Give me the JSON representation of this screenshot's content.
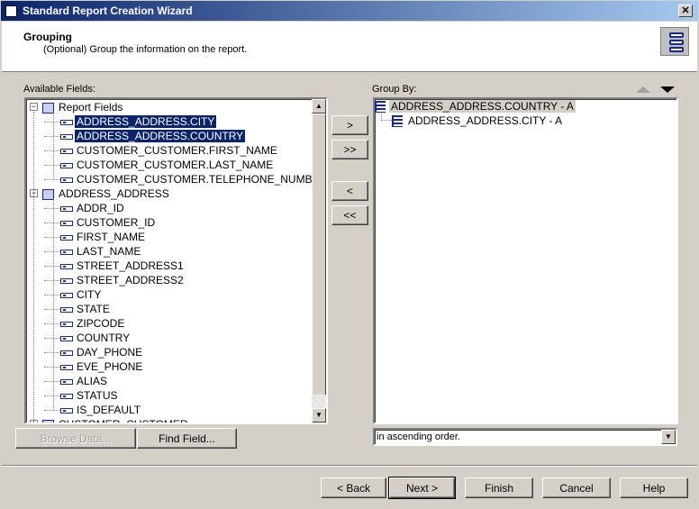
{
  "window": {
    "title": "Standard Report Creation Wizard",
    "close": "✕"
  },
  "header": {
    "title": "Grouping",
    "subtitle": "(Optional) Group the information on the report."
  },
  "available": {
    "label": "Available Fields:",
    "tree": [
      {
        "label": "Report Fields",
        "level": 0,
        "type": "root",
        "expand": "−"
      },
      {
        "label": "ADDRESS_ADDRESS.CITY",
        "level": 1,
        "selected": true
      },
      {
        "label": "ADDRESS_ADDRESS.COUNTRY",
        "level": 1,
        "selected": true
      },
      {
        "label": "CUSTOMER_CUSTOMER.FIRST_NAME",
        "level": 1
      },
      {
        "label": "CUSTOMER_CUSTOMER.LAST_NAME",
        "level": 1
      },
      {
        "label": "CUSTOMER_CUSTOMER.TELEPHONE_NUMBER",
        "level": 1
      },
      {
        "label": "ADDRESS_ADDRESS",
        "level": 0,
        "type": "table",
        "expand": "−"
      },
      {
        "label": "ADDR_ID",
        "level": 1
      },
      {
        "label": "CUSTOMER_ID",
        "level": 1
      },
      {
        "label": "FIRST_NAME",
        "level": 1
      },
      {
        "label": "LAST_NAME",
        "level": 1
      },
      {
        "label": "STREET_ADDRESS1",
        "level": 1
      },
      {
        "label": "STREET_ADDRESS2",
        "level": 1
      },
      {
        "label": "CITY",
        "level": 1
      },
      {
        "label": "STATE",
        "level": 1
      },
      {
        "label": "ZIPCODE",
        "level": 1
      },
      {
        "label": "COUNTRY",
        "level": 1
      },
      {
        "label": "DAY_PHONE",
        "level": 1
      },
      {
        "label": "EVE_PHONE",
        "level": 1
      },
      {
        "label": "ALIAS",
        "level": 1
      },
      {
        "label": "STATUS",
        "level": 1
      },
      {
        "label": "IS_DEFAULT",
        "level": 1
      },
      {
        "label": "CUSTOMER_CUSTOMER",
        "level": 0,
        "type": "table",
        "expand": "+"
      }
    ]
  },
  "transfer": {
    "add": ">",
    "add_all": ">>",
    "remove": "<",
    "remove_all": "<<"
  },
  "groupby": {
    "label": "Group By:",
    "items": [
      {
        "label": "ADDRESS_ADDRESS.COUNTRY - A",
        "level": 0
      },
      {
        "label": "ADDRESS_ADDRESS.CITY - A",
        "level": 1
      }
    ],
    "order": "in ascending order."
  },
  "buttons": {
    "browse": "Browse Data...",
    "find": "Find Field...",
    "back": "< Back",
    "next": "Next >",
    "finish": "Finish",
    "cancel": "Cancel",
    "help": "Help"
  }
}
